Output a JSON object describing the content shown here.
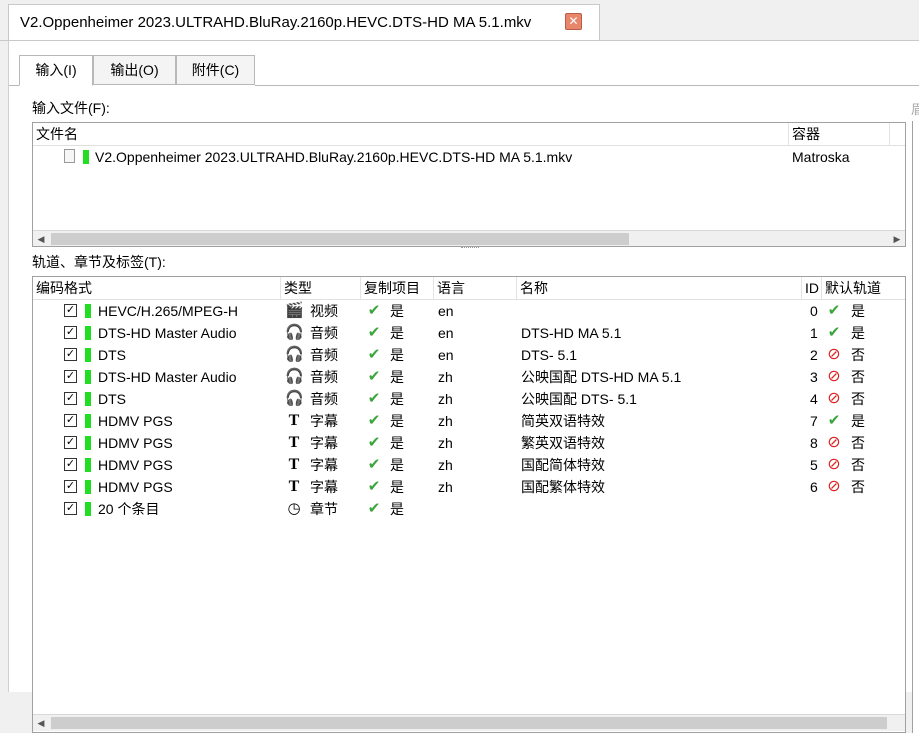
{
  "document_tab": {
    "title": "V2.Oppenheimer 2023.ULTRAHD.BluRay.2160p.HEVC.DTS-HD MA 5.1.mkv",
    "close": "✕"
  },
  "subtabs": [
    {
      "label": "输入(I)"
    },
    {
      "label": "输出(O)"
    },
    {
      "label": "附件(C)"
    }
  ],
  "input_files": {
    "label": "输入文件(F):",
    "columns": [
      "文件名",
      "容器"
    ],
    "rows": [
      {
        "name": "V2.Oppenheimer 2023.ULTRAHD.BluRay.2160p.HEVC.DTS-HD MA 5.1.mkv",
        "container": "Matroska"
      }
    ]
  },
  "side_hint": "眉",
  "tracks": {
    "label": "轨道、章节及标签(T):",
    "columns": [
      "编码格式",
      "类型",
      "复制项目",
      "语言",
      "名称",
      "ID",
      "默认轨道"
    ],
    "rows": [
      {
        "codec": "HEVC/H.265/MPEG-H",
        "type_icon": "clapper-icon",
        "type": "视频",
        "copy": "是",
        "lang": "en",
        "name": "",
        "id": "0",
        "default_icon": "check-icon",
        "default": "是"
      },
      {
        "codec": "DTS-HD Master Audio",
        "type_icon": "headphones-icon",
        "type": "音频",
        "copy": "是",
        "lang": "en",
        "name": "DTS-HD MA 5.1",
        "id": "1",
        "default_icon": "check-icon",
        "default": "是"
      },
      {
        "codec": "DTS",
        "type_icon": "headphones-icon",
        "type": "音频",
        "copy": "是",
        "lang": "en",
        "name": "DTS- 5.1",
        "id": "2",
        "default_icon": "no-icon",
        "default": "否"
      },
      {
        "codec": "DTS-HD Master Audio",
        "type_icon": "headphones-icon",
        "type": "音频",
        "copy": "是",
        "lang": "zh",
        "name": "公映国配 DTS-HD MA 5.1",
        "id": "3",
        "default_icon": "no-icon",
        "default": "否"
      },
      {
        "codec": "DTS",
        "type_icon": "headphones-icon",
        "type": "音频",
        "copy": "是",
        "lang": "zh",
        "name": "公映国配 DTS- 5.1",
        "id": "4",
        "default_icon": "no-icon",
        "default": "否"
      },
      {
        "codec": "HDMV PGS",
        "type_icon": "text-icon",
        "type": "字幕",
        "copy": "是",
        "lang": "zh",
        "name": "简英双语特效",
        "id": "7",
        "default_icon": "check-icon",
        "default": "是"
      },
      {
        "codec": "HDMV PGS",
        "type_icon": "text-icon",
        "type": "字幕",
        "copy": "是",
        "lang": "zh",
        "name": "繁英双语特效",
        "id": "8",
        "default_icon": "no-icon",
        "default": "否"
      },
      {
        "codec": "HDMV PGS",
        "type_icon": "text-icon",
        "type": "字幕",
        "copy": "是",
        "lang": "zh",
        "name": "国配简体特效",
        "id": "5",
        "default_icon": "no-icon",
        "default": "否"
      },
      {
        "codec": "HDMV PGS",
        "type_icon": "text-icon",
        "type": "字幕",
        "copy": "是",
        "lang": "zh",
        "name": "国配繁体特效",
        "id": "6",
        "default_icon": "no-icon",
        "default": "否"
      },
      {
        "codec": "20 个条目",
        "type_icon": "clock-icon",
        "type": "章节",
        "copy": "是",
        "lang": "",
        "name": "",
        "id": "",
        "default_icon": "",
        "default": ""
      }
    ]
  },
  "colors": {
    "accent_green": "#22dd22",
    "check_green": "#3aa53a",
    "no_red": "#dd2222",
    "close_bg": "#e8866c"
  }
}
